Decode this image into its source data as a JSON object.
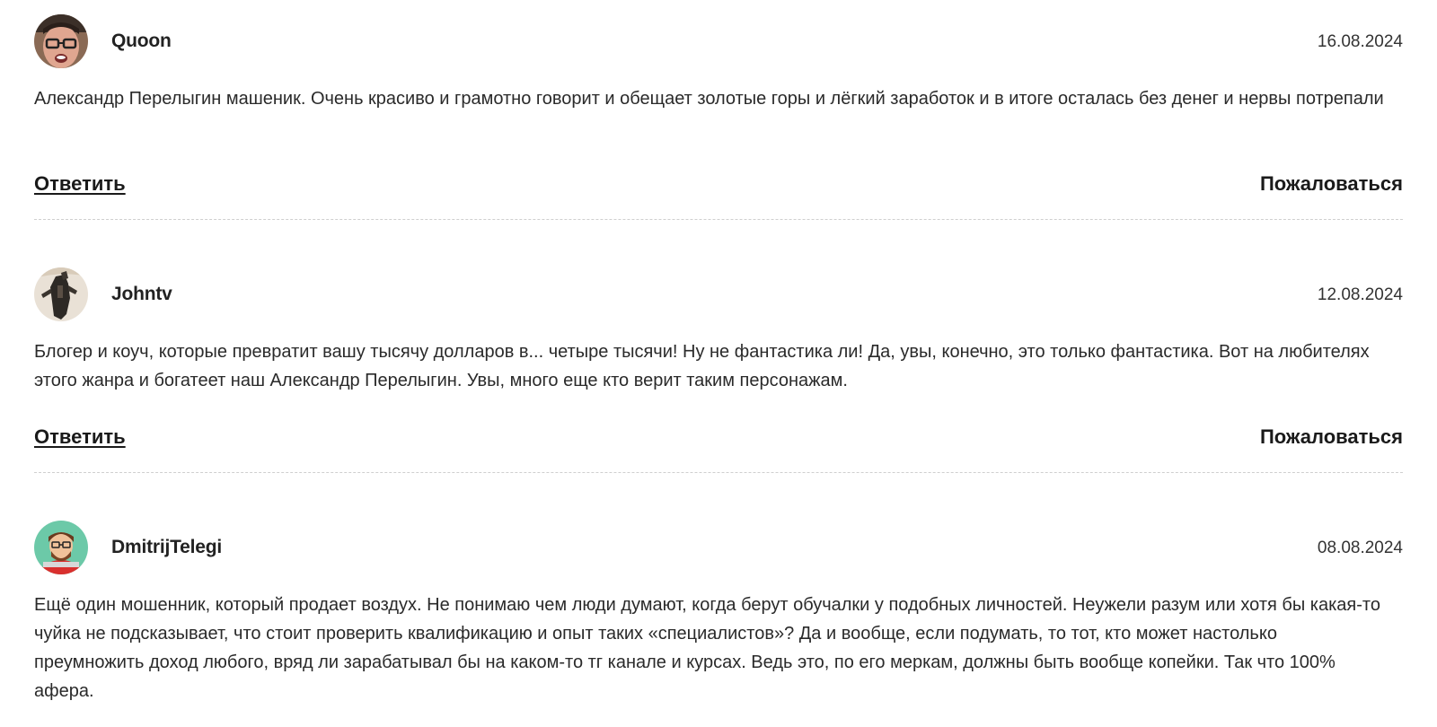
{
  "comments": [
    {
      "author": "Quoon",
      "date": "16.08.2024",
      "avatar_icon": "man-glasses-avatar-icon",
      "text": "Александр Перелыгин машеник. Очень красиво и грамотно говорит и обещает золотые горы и лёгкий заработок и в итоге осталась без денег и нервы потрепали",
      "reply_label": "Ответить",
      "report_label": "Пожаловаться"
    },
    {
      "author": "Johntv",
      "date": "12.08.2024",
      "avatar_icon": "figure-photo-avatar-icon",
      "text": "Блогер и коуч, которые превратит вашу тысячу долларов в... четыре тысячи! Ну не фантастика ли! Да, увы, конечно, это только фантастика. Вот на любителях этого жанра и богатеет наш Александр Перелыгин. Увы, много еще кто верит таким персонажам.",
      "reply_label": "Ответить",
      "report_label": "Пожаловаться"
    },
    {
      "author": "DmitrijTelegi",
      "date": "08.08.2024",
      "avatar_icon": "cartoon-man-avatar-icon",
      "text": "Ещё один мошенник, который продает воздух. Не понимаю чем люди думают, когда берут обучалки у подобных личностей. Неужели разум или хотя бы какая-то чуйка не подсказывает, что стоит проверить квалификацию и опыт таких «специалистов»? Да и вообще, если подумать, то тот, кто может настолько преумножить доход любого, вряд ли зарабатывал бы на каком-то тг канале и курсах. Ведь это, по его меркам, должны быть вообще копейки. Так что 100% афера."
    }
  ]
}
